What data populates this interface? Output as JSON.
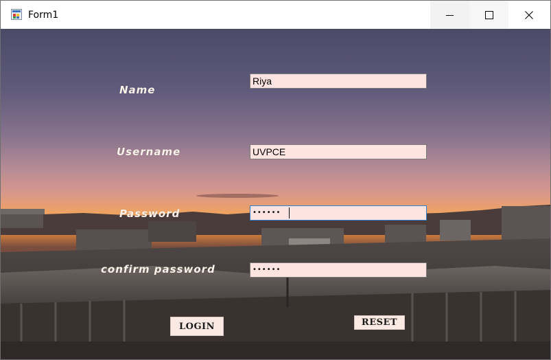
{
  "window": {
    "title": "Form1",
    "icon": "winforms-app-icon",
    "controls": {
      "minimize": "minimize-icon",
      "maximize": "maximize-icon",
      "close": "close-icon"
    }
  },
  "form": {
    "name_label": "Name",
    "name_value": "Riya",
    "username_label": "Username",
    "username_value": "UVPCE",
    "password_label": "Password",
    "password_value": "••••••",
    "confirm_label": "confirm password",
    "confirm_value": "••••••",
    "login_button": "LOGIN",
    "reset_button": "RESET"
  },
  "colors": {
    "field_background": "#fde4e1",
    "label_text": "#fbf3ea",
    "focus_border": "#2f7fd1",
    "button_background": "#fbe9e3"
  }
}
